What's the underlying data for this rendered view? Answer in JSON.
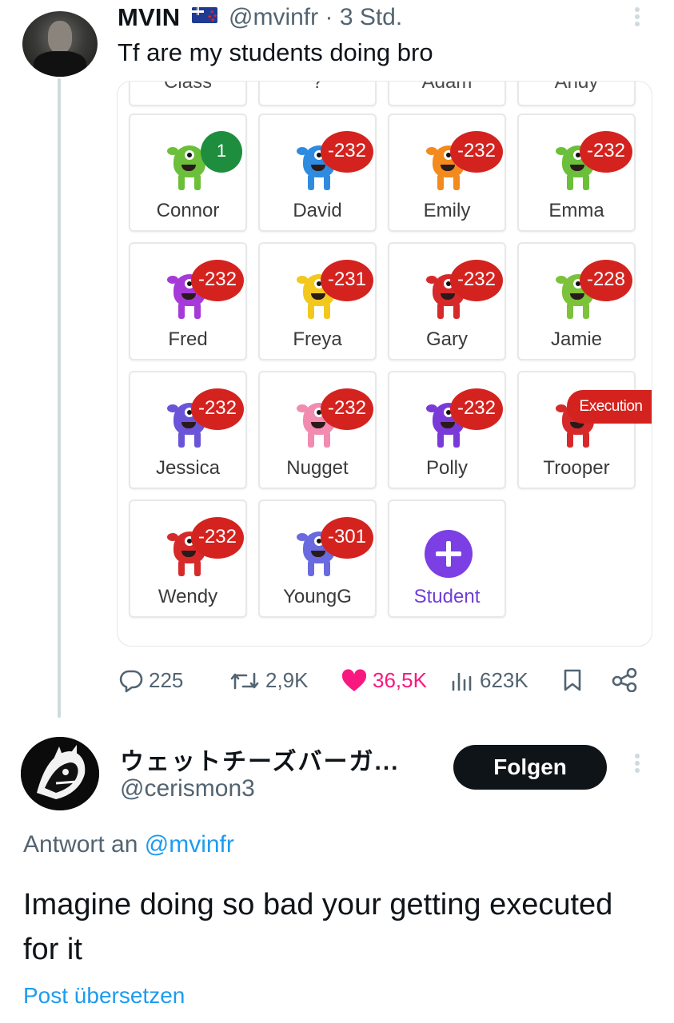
{
  "tweet": {
    "author_name": "MVIN",
    "author_handle": "@mvinfr",
    "separator": "·",
    "time": "3 Std.",
    "text": "Tf are my students doing bro"
  },
  "classroom": {
    "top_row": [
      "Class",
      "?",
      "Adam",
      "Andy"
    ],
    "students": [
      {
        "name": "Connor",
        "points": "1",
        "color": "#6bbf3a",
        "badge": "green"
      },
      {
        "name": "David",
        "points": "-232",
        "color": "#2f8be0",
        "badge": "red"
      },
      {
        "name": "Emily",
        "points": "-232",
        "color": "#f28a1e",
        "badge": "red"
      },
      {
        "name": "Emma",
        "points": "-232",
        "color": "#6bbf3a",
        "badge": "red"
      },
      {
        "name": "Fred",
        "points": "-232",
        "color": "#a63ad8",
        "badge": "red"
      },
      {
        "name": "Freya",
        "points": "-231",
        "color": "#f2c81e",
        "badge": "red"
      },
      {
        "name": "Gary",
        "points": "-232",
        "color": "#d62a2a",
        "badge": "red"
      },
      {
        "name": "Jamie",
        "points": "-228",
        "color": "#7cc23a",
        "badge": "red"
      },
      {
        "name": "Jessica",
        "points": "-232",
        "color": "#6a55d8",
        "badge": "red"
      },
      {
        "name": "Nugget",
        "points": "-232",
        "color": "#f28bb0",
        "badge": "red"
      },
      {
        "name": "Polly",
        "points": "-232",
        "color": "#7a3ad8",
        "badge": "red"
      },
      {
        "name": "Trooper",
        "points": "Execution",
        "color": "#d62a2a",
        "badge": "exec"
      },
      {
        "name": "Wendy",
        "points": "-232",
        "color": "#d62a2a",
        "badge": "red"
      },
      {
        "name": "YoungG",
        "points": "-301",
        "color": "#6a6ae0",
        "badge": "red"
      }
    ],
    "add_label": "Student"
  },
  "actions": {
    "replies": "225",
    "reposts": "2,9K",
    "likes": "36,5K",
    "views": "623K"
  },
  "reply": {
    "author_name": "ウェットチーズバーガ...",
    "author_handle": "@cerismon3",
    "follow_label": "Folgen",
    "reply_to_prefix": "Antwort an",
    "reply_to_handle": "@mvinfr",
    "text": "Imagine doing so bad your getting executed for it",
    "translate_label": "Post übersetzen"
  },
  "colors": {
    "like": "#f91880",
    "link": "#1d9bf0",
    "badge_red": "#d4231f",
    "badge_green": "#1e8e3e",
    "add_purple": "#7b3fe4"
  }
}
